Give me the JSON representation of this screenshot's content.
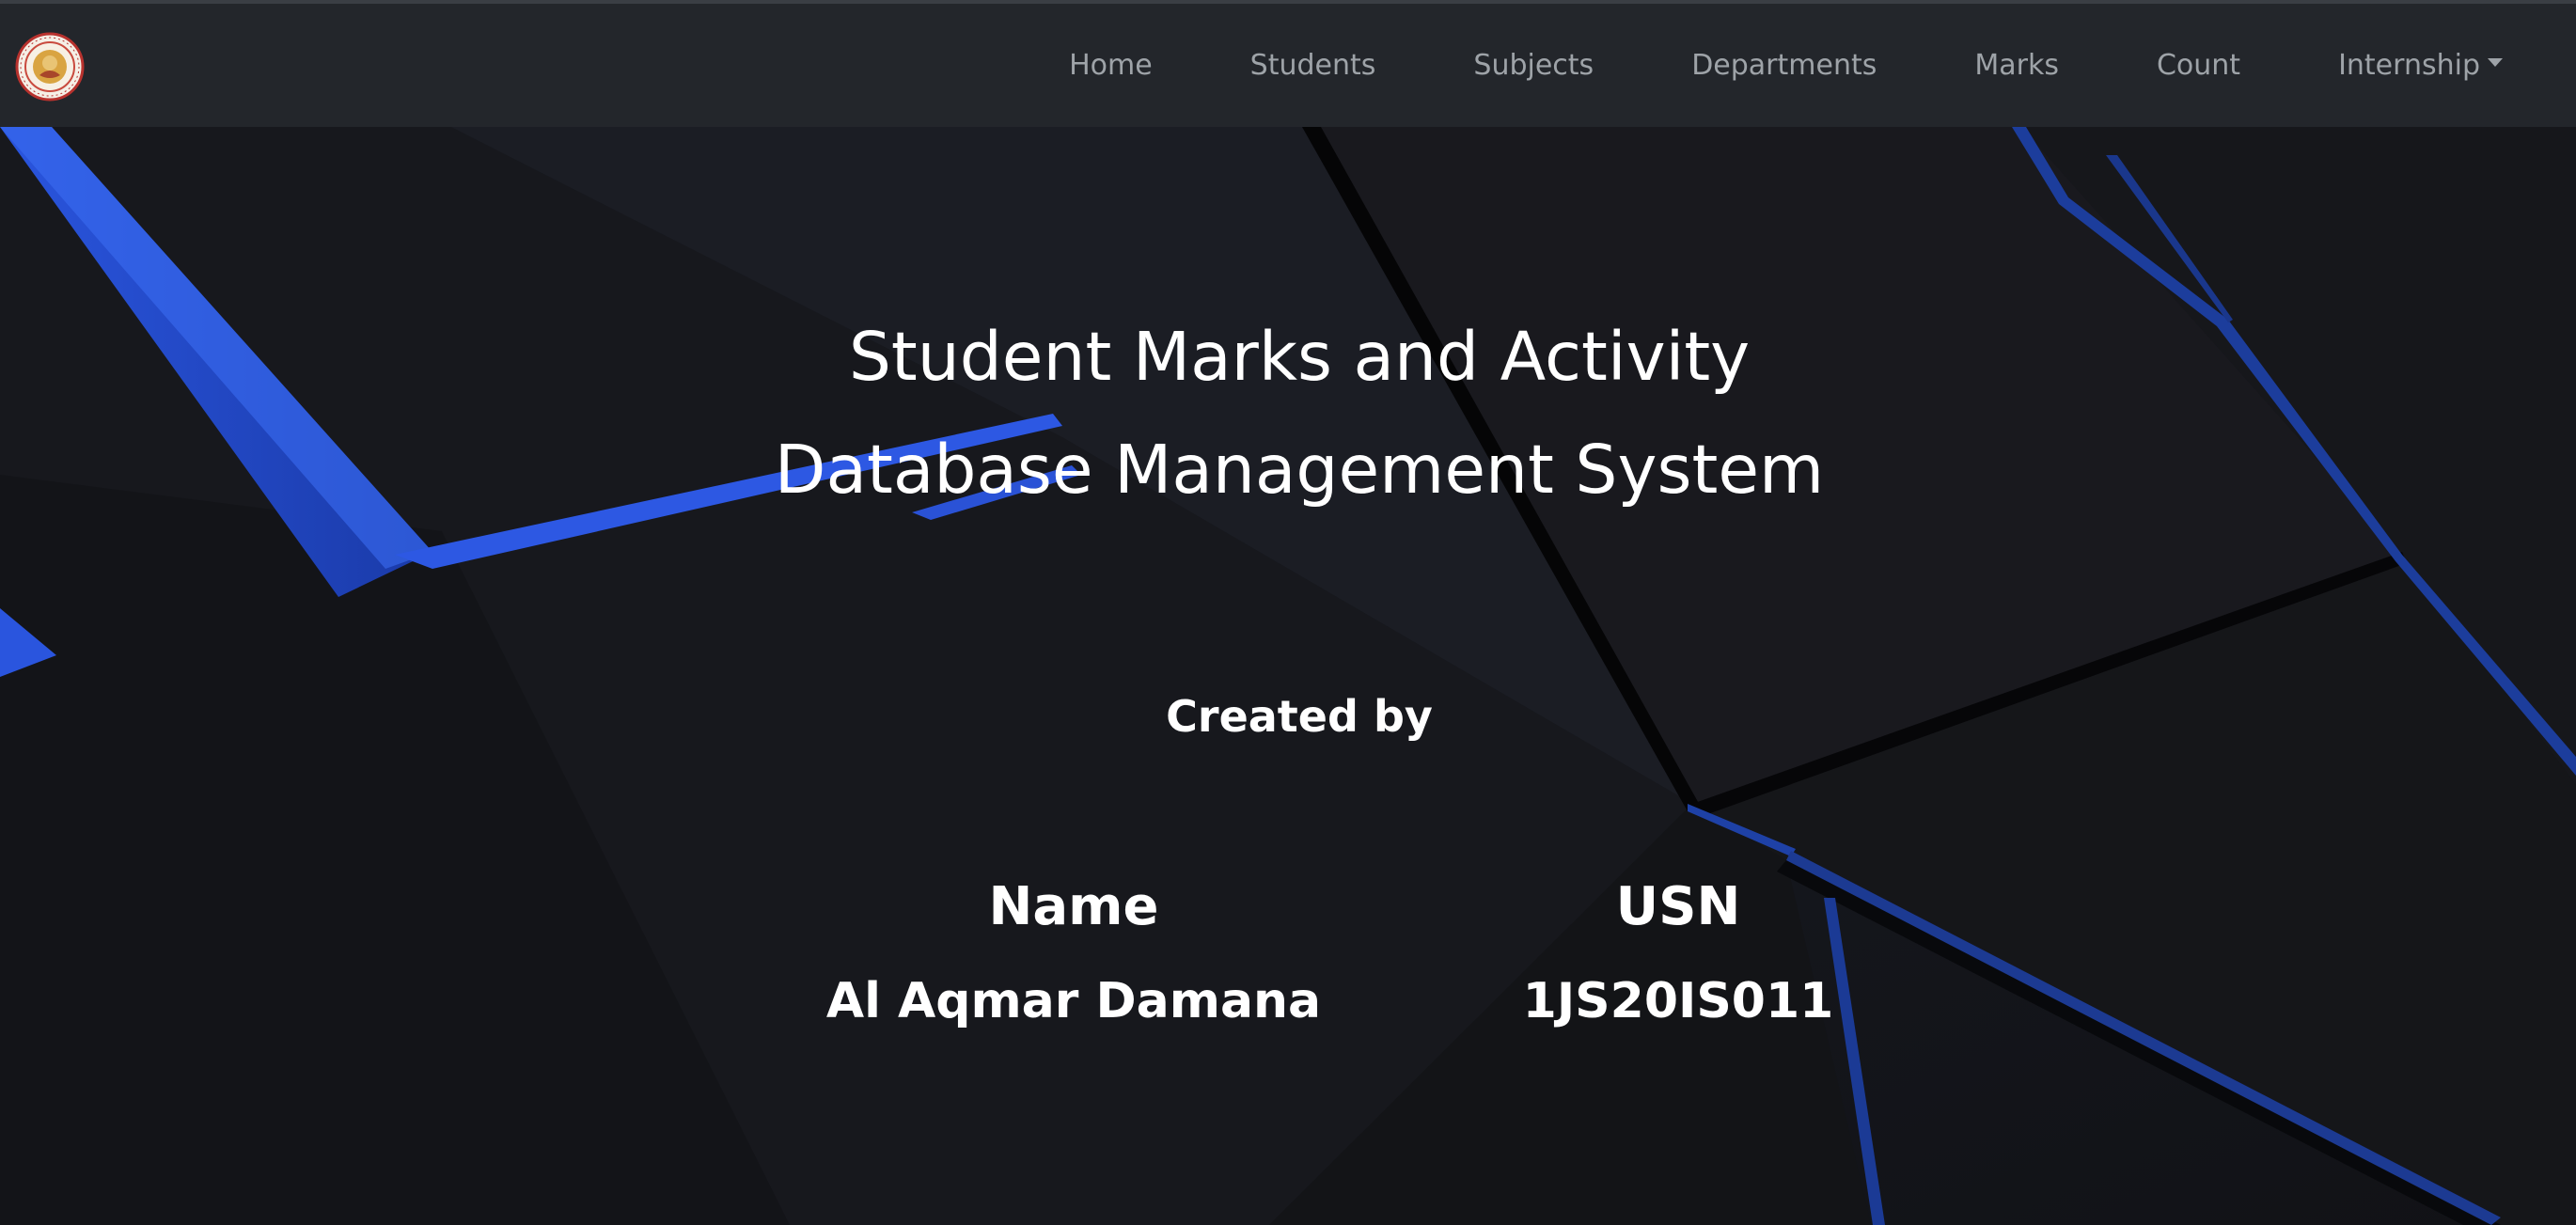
{
  "navbar": {
    "logo_name": "college-seal-logo",
    "links": [
      {
        "label": "Home"
      },
      {
        "label": "Students"
      },
      {
        "label": "Subjects"
      },
      {
        "label": "Departments"
      },
      {
        "label": "Marks"
      },
      {
        "label": "Count"
      },
      {
        "label": "Internship",
        "dropdown": true
      }
    ]
  },
  "hero": {
    "title_line1": "Student Marks and Activity",
    "title_line2": "Database Management System",
    "created_by": "Created by"
  },
  "creators": {
    "name_header": "Name",
    "usn_header": "USN",
    "rows": [
      {
        "name": "Al Aqmar Damana",
        "usn": "1JS20IS011"
      }
    ]
  },
  "colors": {
    "navbar_bg": "#23262b",
    "nav_link": "#9ea3a8",
    "page_bg": "#141519",
    "accent_blue": "#2f5ce8",
    "text": "#ffffff"
  }
}
